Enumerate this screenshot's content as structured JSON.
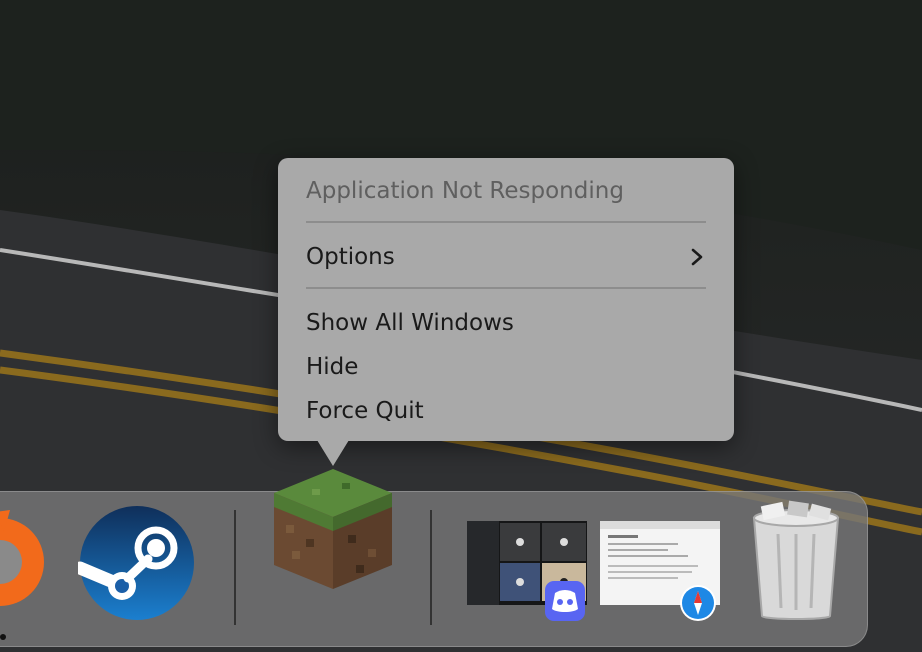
{
  "context_menu": {
    "title": "Application Not Responding",
    "options_label": "Options",
    "items": [
      {
        "label": "Show All Windows"
      },
      {
        "label": "Hide"
      },
      {
        "label": "Force Quit"
      }
    ]
  },
  "dock": {
    "apps": [
      {
        "name": "origin-icon"
      },
      {
        "name": "steam-icon"
      },
      {
        "name": "minecraft-icon"
      },
      {
        "name": "discord-window-preview"
      },
      {
        "name": "safari-window-preview"
      },
      {
        "name": "trash-icon"
      }
    ]
  },
  "colors": {
    "menu_background": "#a9a9a9",
    "dock_background": "#767676",
    "steam_blue": "#1b5fa8"
  }
}
